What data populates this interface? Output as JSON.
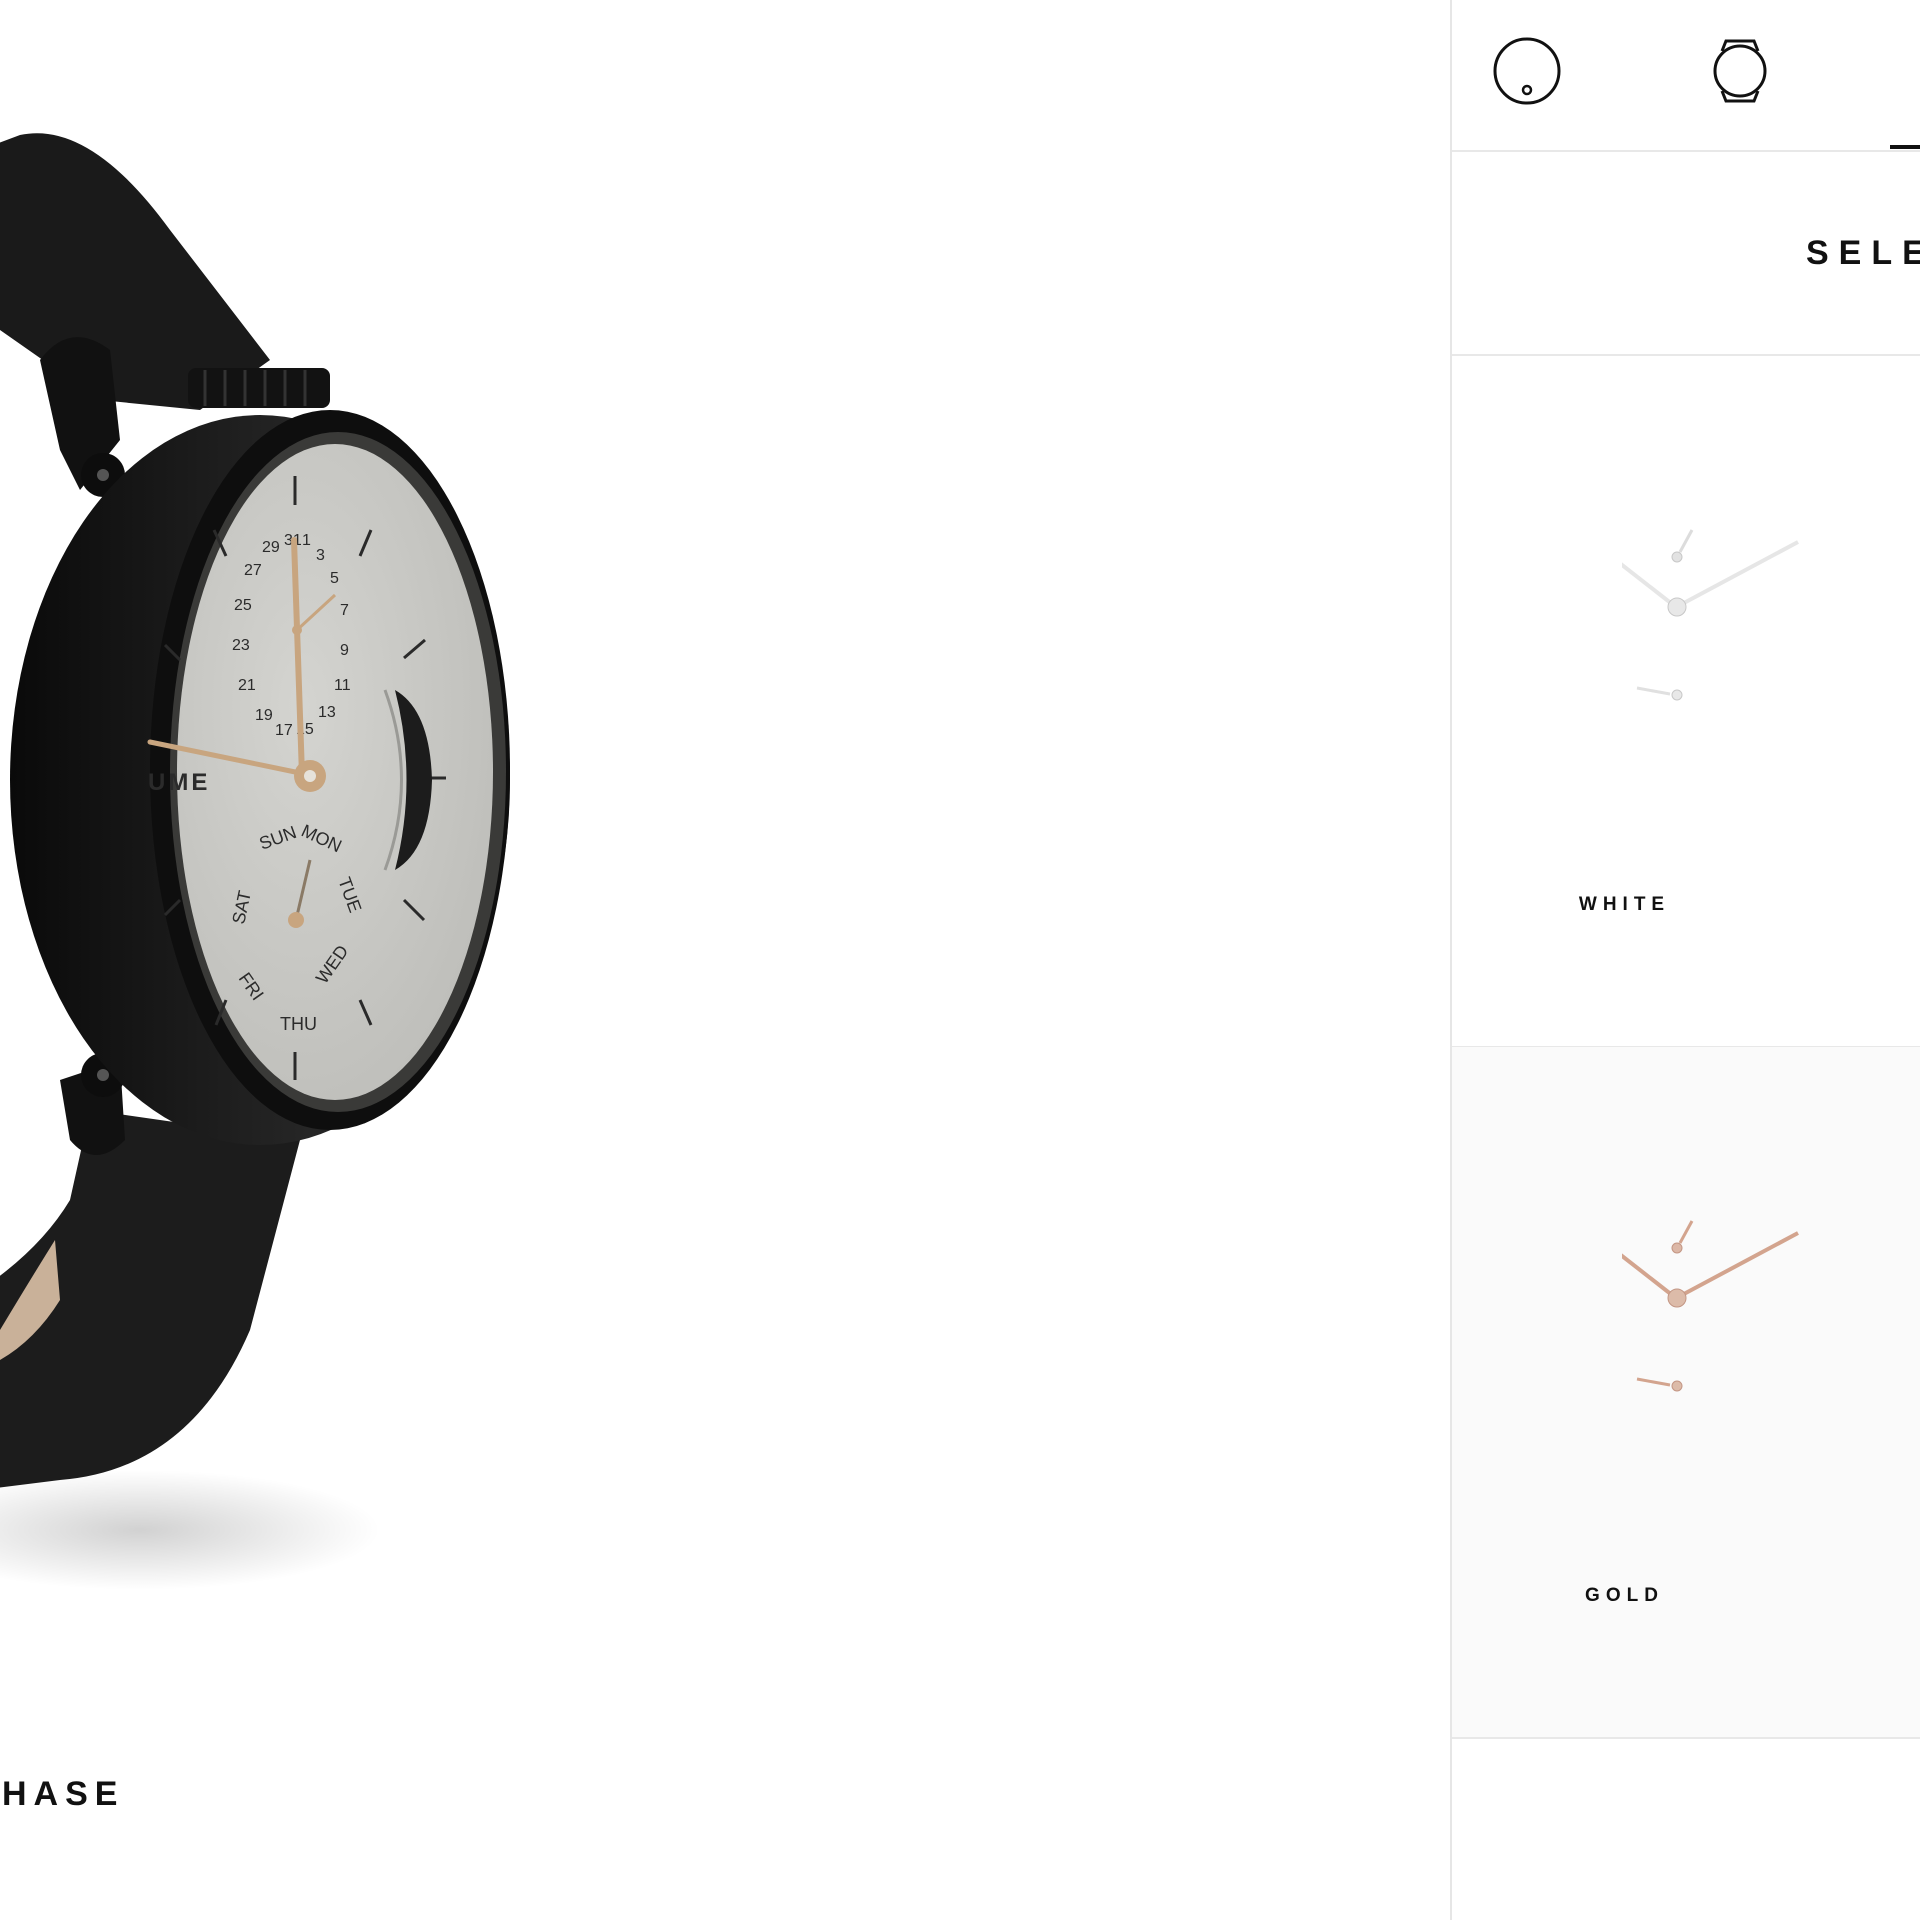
{
  "product": {
    "name": "HASE",
    "dial": {
      "brand_fragment": "UME",
      "dates": [
        "31",
        "1",
        "3",
        "5",
        "7",
        "9",
        "11",
        "13",
        "15",
        "17",
        "19",
        "21",
        "23",
        "25",
        "27",
        "29"
      ],
      "days": [
        "SUN",
        "MON",
        "TUE",
        "WED",
        "THU",
        "FRI",
        "SAT"
      ]
    }
  },
  "panel": {
    "tabs": [
      {
        "label": "",
        "icon": "watch-face-icon"
      },
      {
        "label": "",
        "icon": "watch-case-icon"
      }
    ],
    "section_title": "SELE",
    "options": [
      {
        "label": "WHITE",
        "hand_color": "#d9d9d9"
      },
      {
        "label": "GOLD",
        "hand_color": "#d3a48e"
      }
    ]
  },
  "colors": {
    "case": "#141414",
    "dial": "#c9c9c5",
    "hands": "#c8a57f",
    "divider": "#e8e8e8"
  }
}
